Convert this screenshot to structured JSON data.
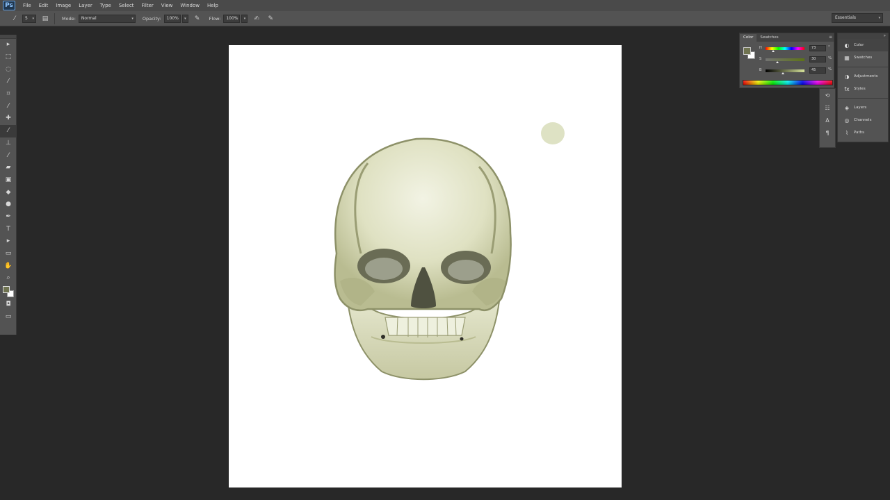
{
  "app": {
    "logo": "Ps"
  },
  "menu": [
    "File",
    "Edit",
    "Image",
    "Layer",
    "Type",
    "Select",
    "Filter",
    "View",
    "Window",
    "Help"
  ],
  "options": {
    "brush_size": "5",
    "mode_label": "Mode:",
    "mode_value": "Normal",
    "opacity_label": "Opacity:",
    "opacity_value": "100%",
    "flow_label": "Flow:",
    "flow_value": "100%"
  },
  "workspace": {
    "value": "Essentials"
  },
  "colors": {
    "foreground": "#6f7350",
    "background": "#ffffff",
    "skull_bone": "#dfe1c2",
    "skull_shadow": "#8d9168",
    "ui_panel": "#535353",
    "ui_dark": "#282828"
  },
  "tools": [
    {
      "name": "move-tool-icon",
      "glyph": "▸"
    },
    {
      "name": "marquee-tool-icon",
      "glyph": "⬚"
    },
    {
      "name": "lasso-tool-icon",
      "glyph": "◌"
    },
    {
      "name": "quick-select-tool-icon",
      "glyph": "⁄"
    },
    {
      "name": "crop-tool-icon",
      "glyph": "⌗"
    },
    {
      "name": "eyedropper-tool-icon",
      "glyph": "⁄"
    },
    {
      "name": "healing-brush-tool-icon",
      "glyph": "✚"
    },
    {
      "name": "brush-tool-icon",
      "glyph": "⁄"
    },
    {
      "name": "clone-stamp-tool-icon",
      "glyph": "⊥"
    },
    {
      "name": "history-brush-tool-icon",
      "glyph": "⁄"
    },
    {
      "name": "eraser-tool-icon",
      "glyph": "▰"
    },
    {
      "name": "gradient-tool-icon",
      "glyph": "▣"
    },
    {
      "name": "blur-tool-icon",
      "glyph": "◆"
    },
    {
      "name": "dodge-tool-icon",
      "glyph": "●"
    },
    {
      "name": "pen-tool-icon",
      "glyph": "✒"
    },
    {
      "name": "type-tool-icon",
      "glyph": "T"
    },
    {
      "name": "path-select-tool-icon",
      "glyph": "▸"
    },
    {
      "name": "shape-tool-icon",
      "glyph": "▭"
    },
    {
      "name": "hand-tool-icon",
      "glyph": "✋"
    },
    {
      "name": "zoom-tool-icon",
      "glyph": "⌕"
    }
  ],
  "active_tool_index": 7,
  "color_panel": {
    "tabs": [
      "Color",
      "Swatches"
    ],
    "channels": [
      {
        "label": "H",
        "value": "73",
        "unit": "°"
      },
      {
        "label": "S",
        "value": "30",
        "unit": "%"
      },
      {
        "label": "B",
        "value": "45",
        "unit": "%"
      }
    ],
    "channel_levels": [
      0.2,
      0.3,
      0.45
    ]
  },
  "icon_strip": [
    "history-icon",
    "properties-icon",
    "character-icon",
    "paragraph-icon"
  ],
  "dock": [
    {
      "label": "Color",
      "icon": "color-icon"
    },
    {
      "label": "Swatches",
      "icon": "swatches-icon"
    },
    {
      "label": "Adjustments",
      "icon": "adjustments-icon"
    },
    {
      "label": "Styles",
      "icon": "styles-icon"
    },
    {
      "label": "Layers",
      "icon": "layers-icon"
    },
    {
      "label": "Channels",
      "icon": "channels-icon"
    },
    {
      "label": "Paths",
      "icon": "paths-icon"
    }
  ]
}
